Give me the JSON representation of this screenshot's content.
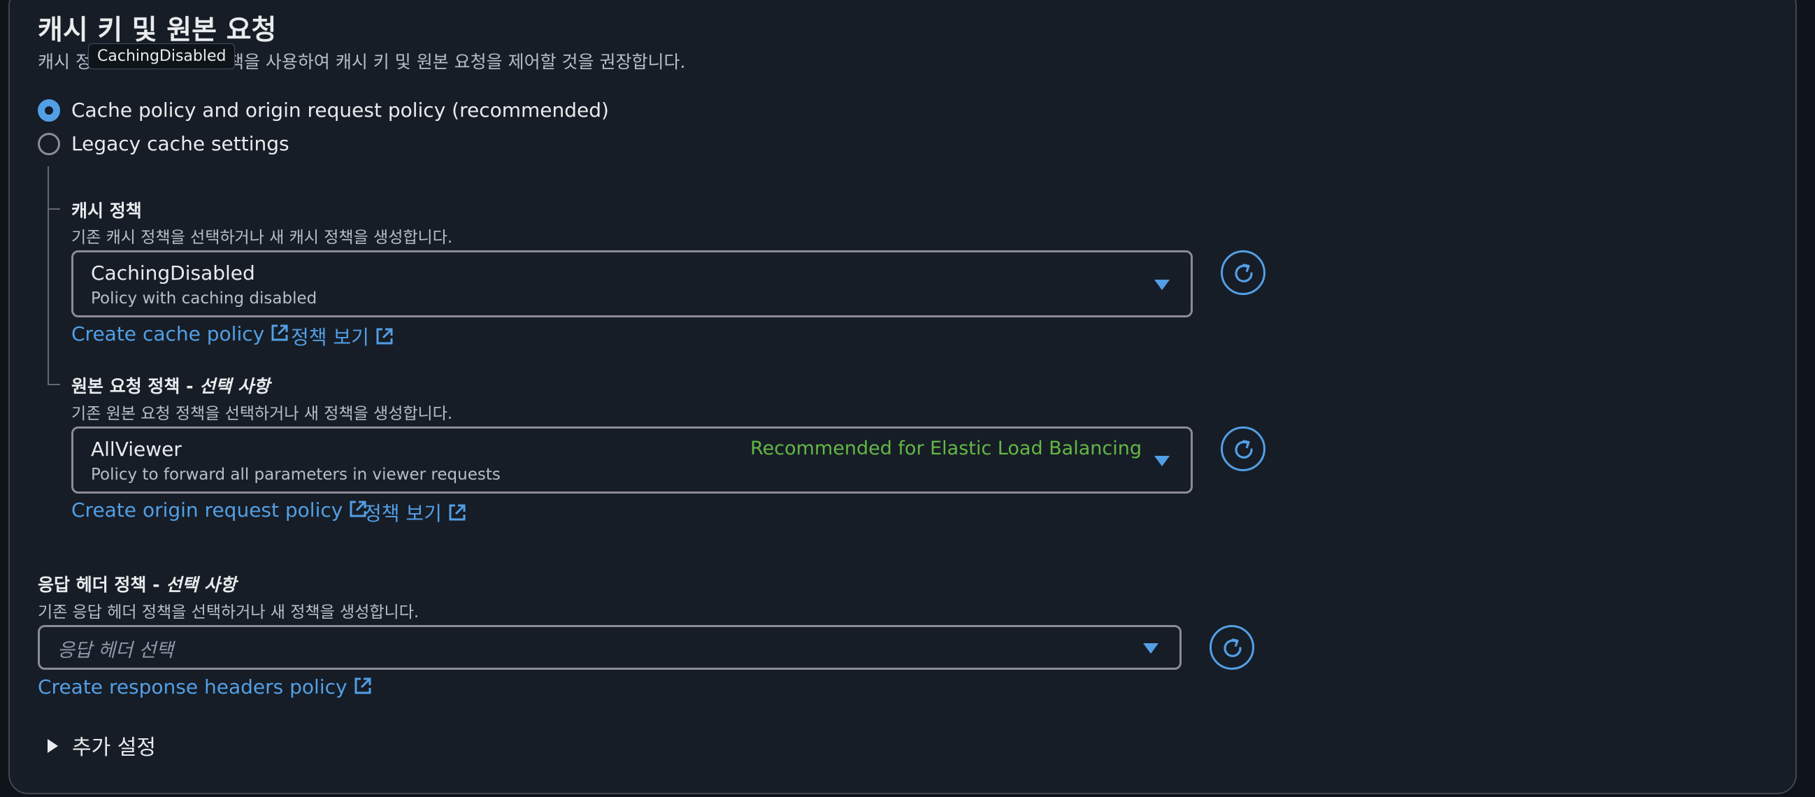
{
  "section": {
    "title": "캐시 키 및 원본 요청",
    "description": "캐시 정책 및 원본 요청 정책을 사용하여 캐시 키 및 원본 요청을 제어할 것을 권장합니다.",
    "description_visible_prefix": "캐시 정",
    "description_visible_suffix": "책을 사용하여 캐시 키 및 원본 요청을 제어할 것을 권장합니다."
  },
  "tooltip": {
    "text": "CachingDisabled"
  },
  "radio_options": [
    {
      "label": "Cache policy and origin request policy (recommended)",
      "selected": true
    },
    {
      "label": "Legacy cache settings",
      "selected": false
    }
  ],
  "cache_policy": {
    "label": "캐시 정책",
    "description": "기존 캐시 정책을 선택하거나 새 캐시 정책을 생성합니다.",
    "selected_title": "CachingDisabled",
    "selected_description": "Policy with caching disabled",
    "create_link": "Create cache policy",
    "view_link": "정책 보기"
  },
  "origin_request_policy": {
    "label": "원본 요청 정책 - ",
    "label_optional": "선택 사항",
    "description": "기존 원본 요청 정책을 선택하거나 새 정책을 생성합니다.",
    "selected_title": "AllViewer",
    "selected_description": "Policy to forward all parameters in viewer requests",
    "tag": "Recommended for Elastic Load Balancing",
    "create_link": "Create origin request policy",
    "view_link": "정책 보기"
  },
  "response_headers_policy": {
    "label": "응답 헤더 정책 - ",
    "label_optional": "선택 사항",
    "description": "기존 응답 헤더 정책을 선택하거나 새 정책을 생성합니다.",
    "placeholder": "응답 헤더 선택",
    "create_link": "Create response headers policy"
  },
  "additional_settings": {
    "label": "추가 설정"
  },
  "colors": {
    "background": "#161d26",
    "accent": "#539fe5",
    "recommended_tag": "#63b746",
    "border": "#8c8c94"
  },
  "icons": [
    "external-link-icon",
    "refresh-icon",
    "caret-down-icon",
    "caret-right-icon"
  ]
}
